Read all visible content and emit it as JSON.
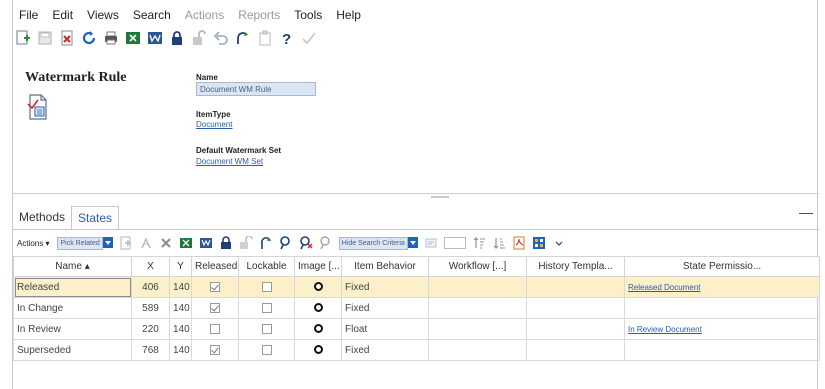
{
  "menu": [
    {
      "label": "File",
      "enabled": true
    },
    {
      "label": "Edit",
      "enabled": true
    },
    {
      "label": "Views",
      "enabled": true
    },
    {
      "label": "Search",
      "enabled": true
    },
    {
      "label": "Actions",
      "enabled": false
    },
    {
      "label": "Reports",
      "enabled": false
    },
    {
      "label": "Tools",
      "enabled": true
    },
    {
      "label": "Help",
      "enabled": true
    }
  ],
  "toolbar_icons": [
    "new-icon",
    "save-icon",
    "delete-icon",
    "refresh-icon",
    "print-icon",
    "excel-icon",
    "word-icon",
    "lock-icon",
    "unlock-icon",
    "undo-icon",
    "redo-icon",
    "copy-icon",
    "help-icon",
    "check-icon"
  ],
  "form": {
    "title": "Watermark Rule",
    "name_label": "Name",
    "name_value": "Document WM Rule",
    "itemtype_label": "ItemType",
    "itemtype_value": "Document",
    "default_set_label": "Default Watermark Set",
    "default_set_value": "Document WM Set"
  },
  "tabs": [
    {
      "label": "Methods",
      "active": false
    },
    {
      "label": "States",
      "active": true
    }
  ],
  "grid_toolbar": {
    "actions_label": "Actions ▾",
    "pick_related": "Pick Related",
    "hide_search": "Hide Search Criteria"
  },
  "grid": {
    "columns": [
      "Name ▴",
      "X",
      "Y",
      "Released",
      "Lockable",
      "Image [...",
      "Item Behavior",
      "Workflow [...]",
      "History Templa...",
      "State Permissio..."
    ],
    "rows": [
      {
        "name": "Released",
        "x": "406",
        "y": "140",
        "released": true,
        "lockable": false,
        "behavior": "Fixed",
        "workflow": "",
        "history": "",
        "permission": "Released Document",
        "selected": true
      },
      {
        "name": "In Change",
        "x": "589",
        "y": "140",
        "released": true,
        "lockable": false,
        "behavior": "Fixed",
        "workflow": "",
        "history": "",
        "permission": "",
        "selected": false
      },
      {
        "name": "In Review",
        "x": "220",
        "y": "140",
        "released": false,
        "lockable": false,
        "behavior": "Float",
        "workflow": "",
        "history": "",
        "permission": "In Review Document",
        "selected": false
      },
      {
        "name": "Superseded",
        "x": "768",
        "y": "140",
        "released": true,
        "lockable": false,
        "behavior": "Fixed",
        "workflow": "",
        "history": "",
        "permission": "",
        "selected": false
      }
    ]
  },
  "colors": {
    "accent": "#1e63b6",
    "selected_row": "#fbf0c9",
    "link": "#2a5db0"
  }
}
